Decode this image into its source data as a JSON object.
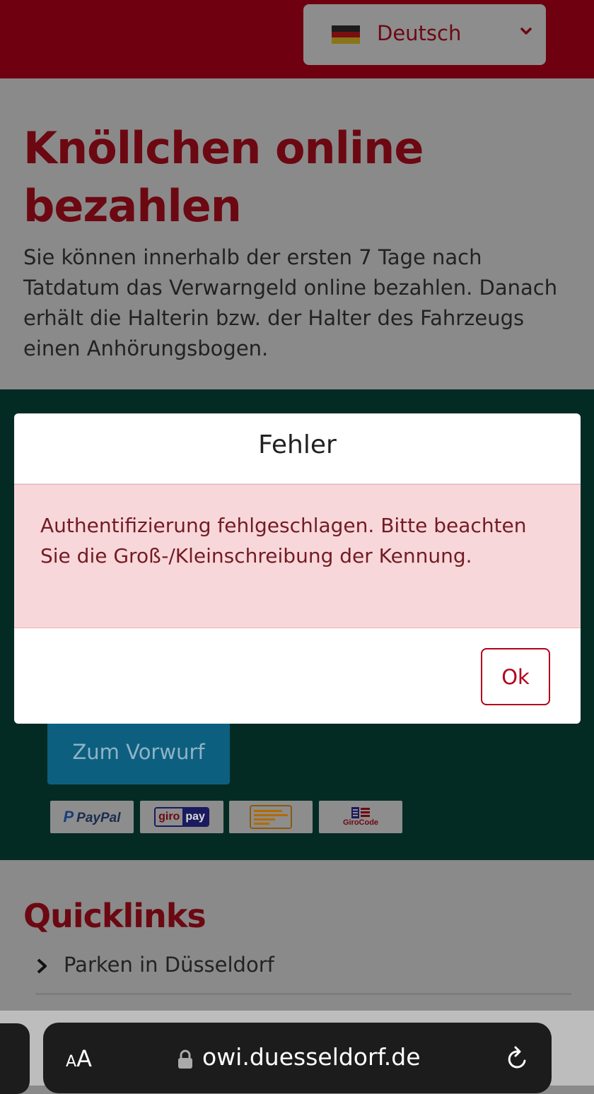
{
  "header": {
    "language_label": "Deutsch",
    "language_flag": "germany-flag-icon",
    "colors": {
      "brand_red": "#6f000f"
    }
  },
  "hero": {
    "title": "Knöllchen online bezahlen",
    "description": "Sie können innerhalb der ersten 7 Tage nach Tatdatum das Verwarngeld online bezahlen. Danach erhält die Halterin bzw. der Halter des Fahrzeugs einen Anhörungsbogen."
  },
  "payment": {
    "button_label": "Zum Vorwurf",
    "logos": [
      {
        "name": "paypal-logo",
        "text_icon": "P",
        "text": "PayPal"
      },
      {
        "name": "giropay-logo",
        "text_a": "giro",
        "text_b": "pay"
      },
      {
        "name": "bank-transfer-logo"
      },
      {
        "name": "girocode-logo",
        "text": "GiroCode"
      }
    ]
  },
  "quicklinks": {
    "title": "Quicklinks",
    "items": [
      {
        "label": "Parken in Düsseldorf"
      }
    ]
  },
  "modal": {
    "title": "Fehler",
    "message": "Authentifizierung fehlgeschlagen. Bitte beachten Sie die Groß-/Kleinschreibung der Kennung.",
    "ok_label": "Ok"
  },
  "browser": {
    "aa_small": "A",
    "aa_large": "A",
    "url": "owi.duesseldorf.de"
  }
}
